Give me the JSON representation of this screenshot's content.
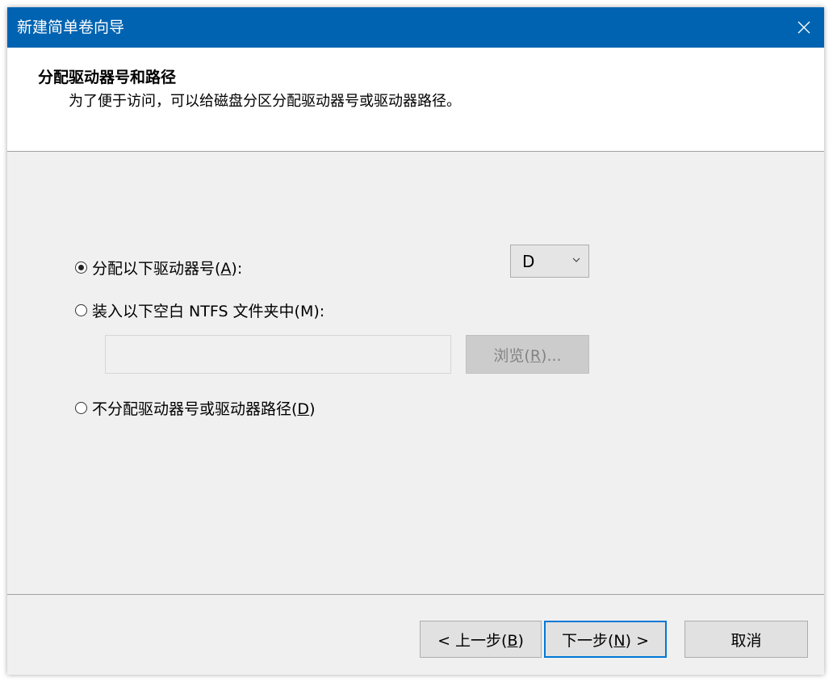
{
  "window": {
    "title": "新建简单卷向导"
  },
  "header": {
    "title": "分配驱动器号和路径",
    "subtitle": "为了便于访问，可以给磁盘分区分配驱动器号或驱动器路径。"
  },
  "options": {
    "assign_letter": {
      "label_pre": "分配以下驱动器号(",
      "accel": "A",
      "label_post": "):",
      "checked": true
    },
    "mount_folder": {
      "label": "装入以下空白 NTFS 文件夹中(M):",
      "checked": false
    },
    "no_assign": {
      "label_pre": "不分配驱动器号或驱动器路径(",
      "accel": "D",
      "label_post": ")",
      "checked": false
    }
  },
  "drive_letter": {
    "selected": "D"
  },
  "folder_path": {
    "value": ""
  },
  "browse_button": {
    "label_pre": "浏览(",
    "accel": "R",
    "label_post": ")..."
  },
  "footer": {
    "back": {
      "label_pre": "< 上一步(",
      "accel": "B",
      "label_post": ")"
    },
    "next": {
      "label_pre": "下一步(",
      "accel": "N",
      "label_post": ") >"
    },
    "cancel": {
      "label": "取消"
    }
  },
  "colors": {
    "titlebar": "#0063b1",
    "primary_border": "#0078d7"
  },
  "icons": {
    "close": "close-icon",
    "dropdown": "chevron-down-icon"
  }
}
